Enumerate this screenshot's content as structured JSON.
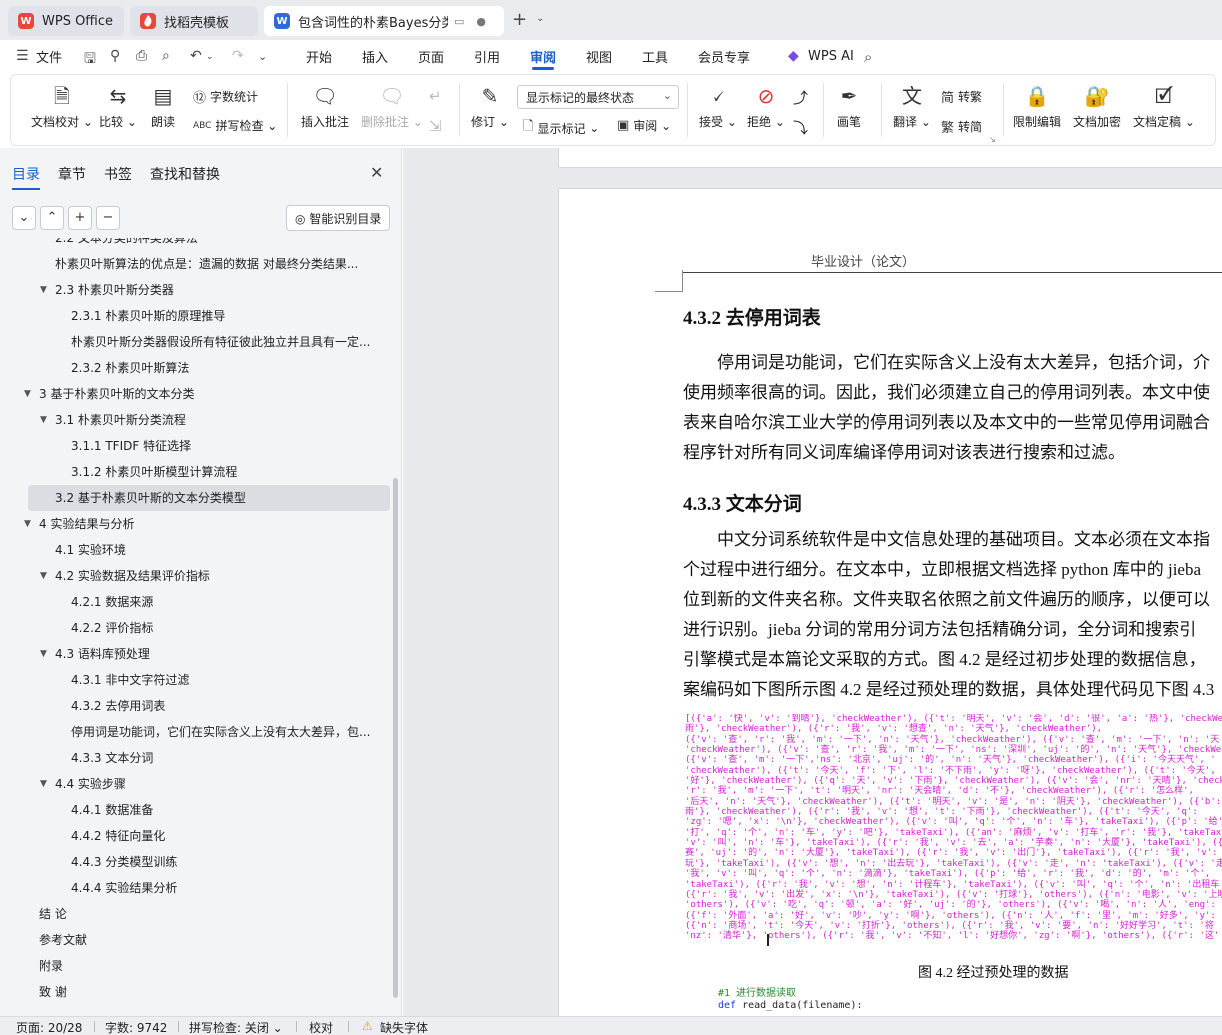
{
  "tabs": [
    {
      "label": "WPS Office",
      "logo": "W",
      "logo_color": "#e8473a"
    },
    {
      "label": "找稻壳模板",
      "logo": "",
      "logo_color": "#e8473a"
    },
    {
      "label": "包含词性的朴素Bayes分类在",
      "logo": "W",
      "logo_color": "#2f6ad9"
    }
  ],
  "menu": {
    "file": "文件",
    "items": [
      "开始",
      "插入",
      "页面",
      "引用",
      "审阅",
      "视图",
      "工具",
      "会员专享"
    ],
    "active": "审阅",
    "ai": "WPS AI"
  },
  "ribbon": {
    "doc_check": "文档校对",
    "compare": "比较",
    "read_aloud": "朗读",
    "word_count": "字数统计",
    "spell_check": "拼写检查",
    "insert_comment": "插入批注",
    "delete_comment": "删除批注",
    "revise": "修订",
    "markup_dropdown": "显示标记的最终状态",
    "show_markup": "显示标记",
    "review_pane": "审阅",
    "accept": "接受",
    "reject": "拒绝",
    "pen": "画笔",
    "translate": "翻译",
    "to_traditional": "转繁",
    "to_simplified": "转简",
    "restrict_edit": "限制编辑",
    "encrypt": "文档加密",
    "finalize": "文档定稿"
  },
  "nav": {
    "tabs": [
      "目录",
      "章节",
      "书签",
      "查找和替换"
    ],
    "active_tab": "目录",
    "smart_button": "智能识别目录",
    "items": [
      {
        "level": 2,
        "text": "2.2   文本分类的种类及算法",
        "caret": false
      },
      {
        "level": 2,
        "text": "朴素贝叶斯算法的优点是：遗漏的数据   对最终分类结果...",
        "caret": false
      },
      {
        "level": 2,
        "text": "2.3  朴素贝叶斯分类器",
        "caret": true
      },
      {
        "level": 3,
        "text": "2.3.1    朴素贝叶斯的原理推导",
        "caret": false
      },
      {
        "level": 3,
        "text": "朴素贝叶斯分类器假设所有特征彼此独立并且具有一定...",
        "caret": false
      },
      {
        "level": 3,
        "text": "2.3.2    朴素贝叶斯算法",
        "caret": false
      },
      {
        "level": 1,
        "text": "3  基于朴素贝叶斯的文本分类",
        "caret": true
      },
      {
        "level": 2,
        "text": "3.1  朴素贝叶斯分类流程",
        "caret": true
      },
      {
        "level": 3,
        "text": "3.1.1 TFIDF 特征选择",
        "caret": false
      },
      {
        "level": 3,
        "text": "3.1.2  朴素贝叶斯模型计算流程",
        "caret": false
      },
      {
        "level": 2,
        "text": "3.2 基于朴素贝叶斯的文本分类模型",
        "caret": false,
        "selected": true
      },
      {
        "level": 1,
        "text": "4  实验结果与分析",
        "caret": true
      },
      {
        "level": 2,
        "text": "4.1 实验环境",
        "caret": false
      },
      {
        "level": 2,
        "text": "4.2 实验数据及结果评价指标",
        "caret": true
      },
      {
        "level": 3,
        "text": "4.2.1  数据来源",
        "caret": false
      },
      {
        "level": 3,
        "text": "4.2.2  评价指标",
        "caret": false
      },
      {
        "level": 2,
        "text": "4.3 语料库预处理",
        "caret": true
      },
      {
        "level": 3,
        "text": "4.3.1  非中文字符过滤",
        "caret": false
      },
      {
        "level": 3,
        "text": "4.3.2  去停用词表",
        "caret": false
      },
      {
        "level": 3,
        "text": "停用词是功能词，它们在实际含义上没有太大差异，包...",
        "caret": false
      },
      {
        "level": 3,
        "text": "4.3.3  文本分词",
        "caret": false
      },
      {
        "level": 2,
        "text": "4.4  实验步骤",
        "caret": true
      },
      {
        "level": 3,
        "text": "4.4.1  数据准备",
        "caret": false
      },
      {
        "level": 3,
        "text": "4.4.2  特征向量化",
        "caret": false
      },
      {
        "level": 3,
        "text": "4.4.3  分类模型训练",
        "caret": false
      },
      {
        "level": 3,
        "text": "4.4.4  实验结果分析",
        "caret": false
      },
      {
        "level": 1,
        "text": "结  论",
        "caret": false
      },
      {
        "level": 1,
        "text": "参考文献",
        "caret": false
      },
      {
        "level": 1,
        "text": "附录",
        "caret": false
      },
      {
        "level": 1,
        "text": "致  谢",
        "caret": false
      }
    ]
  },
  "document": {
    "header": "毕业设计（论文）",
    "heading1": "4.3.2  去停用词表",
    "para1": [
      "停用词是功能词，它们在实际含义上没有太大差异，包括介词，介",
      "使用频率很高的词。因此，我们必须建立自己的停用词列表。本文中使",
      "表来自哈尔滨工业大学的停用词列表以及本文中的一些常见停用词融合",
      "程序针对所有同义词库编译停用词对该表进行搜索和过滤。"
    ],
    "heading2": "4.3.3  文本分词",
    "para2": [
      "中文分词系统软件是中文信息处理的基础项目。文本必须在文本指",
      "个过程中进行细分。在文本中，立即根据文档选择 python 库中的 jieba",
      "位到新的文件夹名称。文件夹取名依照之前文件遍历的顺序，以便可以",
      "进行识别。jieba 分词的常用分词方法包括精确分词，全分词和搜索引",
      "引擎模式是本篇论文采取的方式。图 4.2 是经过初步处理的数据信息，",
      "案编码如下图所示图 4.2 是经过预处理的数据，具体处理代码见下图 4.3"
    ],
    "code_lines": [
      "[({'a': '快', 'v': '到晴'}, 'checkWeather'), ({'t': '明天', 'v': '会', 'd': '很', 'a': '热'}, 'checkWea",
      "雨'}, 'checkWeather'), ({'r': '我', 'v': '想查', 'n': '天气'}, 'checkWeather'),",
      "({'v': '查', 'r': '我', 'm': '一下', 'n': '天气'}, 'checkWeather'), ({'v': '查', 'm': '一下', 'n': '天",
      "'checkWeather'), ({'v': '查', 'r': '我', 'm': '一下', 'ns': '深圳', 'uj': '的', 'n': '天气'}, 'checkWea",
      "({'v': '查', 'm': '一下','ns': '北京', 'uj': '的', 'n': '天气'}, 'checkWeather'), ({'i': '今天天气', '",
      "'checkWeather'), ({'t': '今天', 'f': '下', 'l': '不下雨', 'y': '呀'}, 'checkWeather'), ({'t': '今天',",
      "'好'}, 'checkWeather'), ({'q': '天', 'v': '下雨'}, 'checkWeather'), ({'v': '会', 'nr': '天晴'}, 'check",
      "'r': '我', 'm': '一下', 't': '明天', 'nr': '天会晴', 'd': '不'}, 'checkWeather'), ({'r': '怎么样',",
      "'后天', 'n': '天气'}, 'checkWeather'), ({'t': '明天', 'v': '是', 'n': '阴天'}, 'checkWeather'), ({'b':",
      "雨'}, 'checkWeather'), ({'r': '我', 'v': '想', 't': '下雨'}, 'checkWeather'), ({'t': '今天', 'q':",
      "'zg': '嗯', 'x': '\\n'}, 'checkWeather'), ({'v': '叫', 'q': '个', 'n': '车'}, 'takeTaxi'), ({'p': '给',",
      "'打', 'q': '个', 'n': '车', 'y': '吧'}, 'takeTaxi'), ({'an': '麻烦', 'v': '打车', 'r': '我'}, 'takeTax",
      "'v': '叫', 'n': '车'}, 'takeTaxi'), ({'r': '我', 'v': '去', 'a': '芋奏', 'n': '大厦'}, 'takeTaxi'), ({",
      "赛', 'uj': '的', 'n': '大厦'}, 'takeTaxi'), ({'r': '我', 'v': '出门'}, 'takeTaxi'), ({'r': '我', 'v':",
      "玩'}, 'takeTaxi'), ({'v': '想', 'n': '出去玩'}, 'takeTaxi'), ({'v': '走', 'n': 'takeTaxi'), ({'v': '走',",
      "'我', 'v': '叫', 'q': '个', 'n': '滴滴'}, 'takeTaxi'), ({'p': '给', 'r': '我', 'd': '的', 'm': '个',",
      "'takeTaxi'), ({'r': '我', 'v': '想', 'n': '计程车'}, 'takeTaxi'), ({'v': '叫', 'q': '个', 'n': '出租车",
      "({'r': '我', 'v': '出发', 'x': '\\n'}, 'takeTaxi'), ({'v': '打球'}, 'others'), ({'n': '电影', 'v': '上映",
      "'others'), ({'v': '吃', 'q': '顿', 'a': '好', 'uj': '的'}, 'others'), ({'v': '喝', 'n': '人', 'eng': '",
      "({'f': '外面', 'a': '好', 'v': '吵', 'y': '啊'}, 'others'), ({'n': '人', 'f': '里', 'm': '好多', 'y':",
      "({'n': '商场', 't': '今天', 'v': '打折'}, 'others'), ({'r': '我', 'v': '要', 'n': '好好学习', 't': '将",
      "'nz': '清华'}, 'others'), ({'r': '我', 'v': '不知', 'l': '好想你', 'zg': '啊'}, 'others'), ({'r': '这'"
    ],
    "caption": "图 4.2    经过预处理的数据",
    "code2_comment": "#1 进行数据读取",
    "code2_def": "def",
    "code2_sig": " read_data(filename):"
  },
  "status": {
    "page": "页面: 20/28",
    "words": "字数: 9742",
    "spell": "拼写检查: 关闭",
    "proofread": "校对",
    "missing_font": "缺失字体"
  }
}
